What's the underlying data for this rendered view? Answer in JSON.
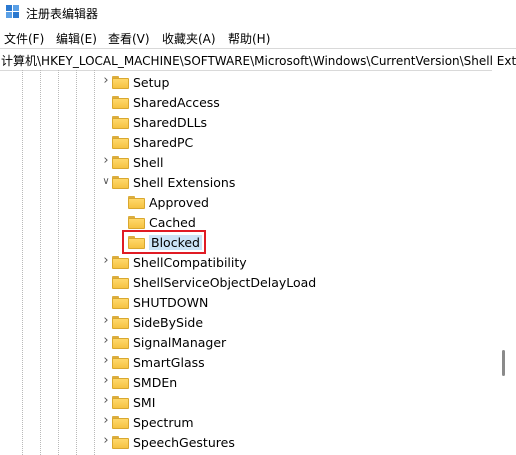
{
  "window": {
    "title": "注册表编辑器",
    "app_icon": "regedit-icon"
  },
  "menu": [
    "文件(F)",
    "编辑(E)",
    "查看(V)",
    "收藏夹(A)",
    "帮助(H)"
  ],
  "address": "计算机\\HKEY_LOCAL_MACHINE\\SOFTWARE\\Microsoft\\Windows\\CurrentVersion\\Shell Exte",
  "tree": [
    {
      "label": "Setup",
      "expander": "collapsed",
      "level": 0
    },
    {
      "label": "SharedAccess",
      "expander": "none",
      "level": 0
    },
    {
      "label": "SharedDLLs",
      "expander": "none",
      "level": 0
    },
    {
      "label": "SharedPC",
      "expander": "none",
      "level": 0
    },
    {
      "label": "Shell",
      "expander": "collapsed",
      "level": 0
    },
    {
      "label": "Shell Extensions",
      "expander": "expanded",
      "level": 0
    },
    {
      "label": "Approved",
      "expander": "none",
      "level": 1
    },
    {
      "label": "Cached",
      "expander": "none",
      "level": 1
    },
    {
      "label": "Blocked",
      "expander": "none",
      "level": 1,
      "selected": true
    },
    {
      "label": "ShellCompatibility",
      "expander": "collapsed",
      "level": 0
    },
    {
      "label": "ShellServiceObjectDelayLoad",
      "expander": "none",
      "level": 0
    },
    {
      "label": "SHUTDOWN",
      "expander": "none",
      "level": 0
    },
    {
      "label": "SideBySide",
      "expander": "collapsed",
      "level": 0
    },
    {
      "label": "SignalManager",
      "expander": "collapsed",
      "level": 0
    },
    {
      "label": "SmartGlass",
      "expander": "collapsed",
      "level": 0
    },
    {
      "label": "SMDEn",
      "expander": "collapsed",
      "level": 0
    },
    {
      "label": "SMI",
      "expander": "collapsed",
      "level": 0
    },
    {
      "label": "Spectrum",
      "expander": "collapsed",
      "level": 0
    },
    {
      "label": "SpeechGestures",
      "expander": "collapsed",
      "level": 0
    }
  ],
  "colors": {
    "highlight_border": "#e01b24",
    "selection": "#cce4f7",
    "folder": "#f5c242"
  }
}
